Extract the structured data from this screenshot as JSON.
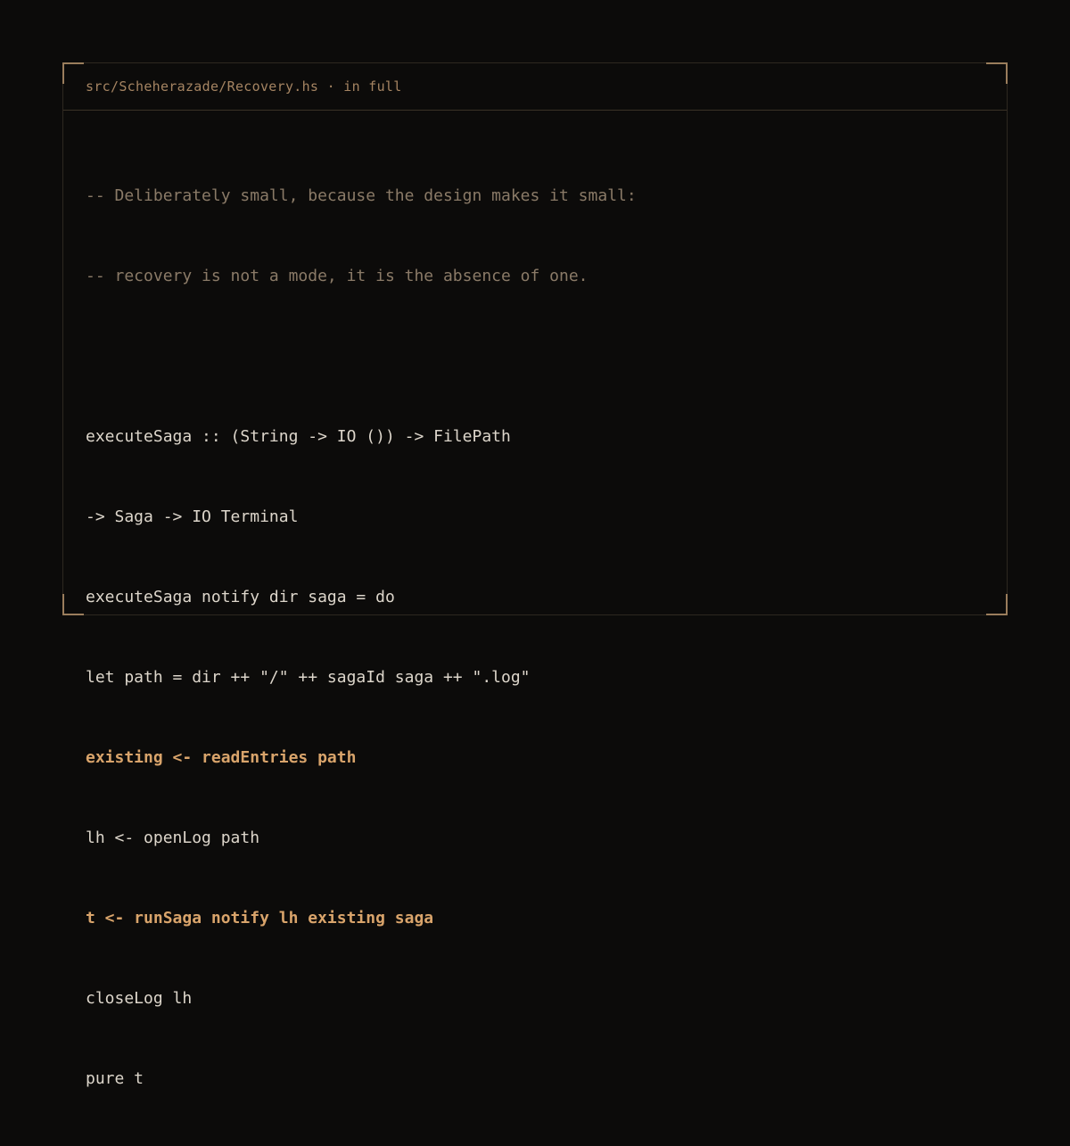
{
  "panel": {
    "title": "src/Scheherazade/Recovery.hs · in full"
  },
  "code": {
    "lines": [
      {
        "text": "-- Deliberately small, because the design makes it small:",
        "style": "comment"
      },
      {
        "text": "-- recovery is not a mode, it is the absence of one.",
        "style": "comment"
      },
      {
        "text": "",
        "style": "blank"
      },
      {
        "text": "executeSaga :: (String -> IO ()) -> FilePath",
        "style": "normal"
      },
      {
        "text": "-> Saga -> IO Terminal",
        "style": "normal"
      },
      {
        "text": "executeSaga notify dir saga = do",
        "style": "normal"
      },
      {
        "text": "let path = dir ++ \"/\" ++ sagaId saga ++ \".log\"",
        "style": "normal"
      },
      {
        "text": "existing <- readEntries path",
        "style": "highlight"
      },
      {
        "text": "lh <- openLog path",
        "style": "normal"
      },
      {
        "text": "t <- runSaga notify lh existing saga",
        "style": "highlight"
      },
      {
        "text": "closeLog lh",
        "style": "normal"
      },
      {
        "text": "pure t",
        "style": "normal"
      }
    ]
  },
  "colors": {
    "background": "#0c0b0a",
    "accent": "#d9a46b",
    "comment": "#8a7a67",
    "text": "#ddd6cb"
  }
}
